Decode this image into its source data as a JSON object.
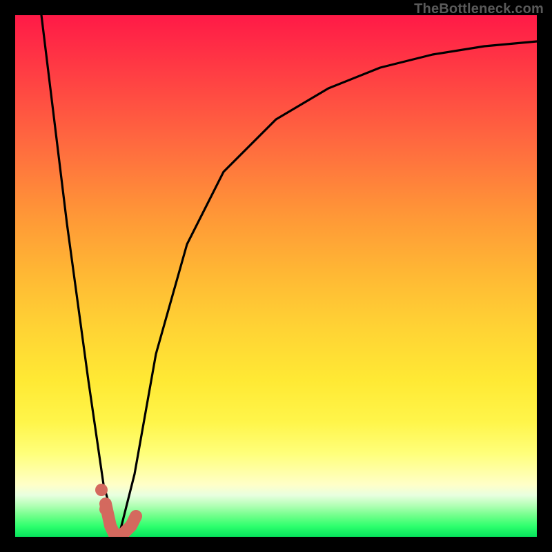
{
  "watermark": {
    "text": "TheBottleneck.com"
  },
  "chart_data": {
    "type": "line",
    "title": "",
    "xlabel": "",
    "ylabel": "",
    "xlim": [
      0,
      100
    ],
    "ylim": [
      0,
      100
    ],
    "grid": false,
    "legend": false,
    "series": [
      {
        "name": "curve",
        "x": [
          5,
          10,
          14,
          17,
          19,
          20,
          23,
          27,
          33,
          40,
          50,
          60,
          70,
          80,
          90,
          100
        ],
        "y": [
          100,
          60,
          30,
          10,
          3,
          0,
          12,
          35,
          56,
          70,
          80,
          86,
          90,
          92.5,
          94,
          95
        ],
        "color": "#000000"
      },
      {
        "name": "highlight-stroke",
        "x": [
          17,
          18,
          19,
          20,
          21,
          22,
          23
        ],
        "y": [
          6,
          2,
          0,
          0,
          1,
          2,
          4
        ],
        "color": "#d4695e"
      },
      {
        "name": "dots",
        "x": [
          16.5,
          17.3
        ],
        "y": [
          9,
          5
        ],
        "color": "#d4695e"
      }
    ]
  }
}
